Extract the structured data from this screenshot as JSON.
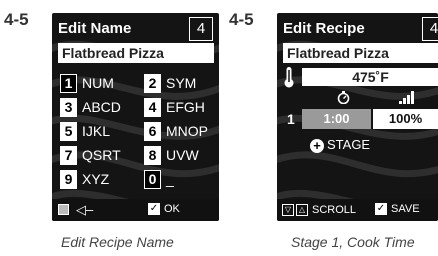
{
  "left": {
    "step_label": "4-5",
    "title": "Edit Name",
    "step_number": "4",
    "name_value": "Flatbread Pizza",
    "keys": [
      {
        "num": "1",
        "label": "NUM"
      },
      {
        "num": "2",
        "label": "SYM"
      },
      {
        "num": "3",
        "label": "ABCD"
      },
      {
        "num": "4",
        "label": "EFGH"
      },
      {
        "num": "5",
        "label": "IJKL"
      },
      {
        "num": "6",
        "label": "MNOP"
      },
      {
        "num": "7",
        "label": "QSRT"
      },
      {
        "num": "8",
        "label": "UVW"
      },
      {
        "num": "9",
        "label": "XYZ"
      },
      {
        "num": "0",
        "label": "_"
      }
    ],
    "bottom_ok": "OK",
    "caption": "Edit Recipe Name"
  },
  "right": {
    "step_label": "4-5",
    "title": "Edit Recipe",
    "step_number": "4",
    "name_value": "Flatbread Pizza",
    "temperature": "475˚F",
    "stage_number": "1",
    "time": "1:00",
    "power": "100%",
    "add_stage": "STAGE",
    "scroll_label": "SCROLL",
    "save_label": "SAVE",
    "caption": "Stage 1, Cook Time"
  }
}
